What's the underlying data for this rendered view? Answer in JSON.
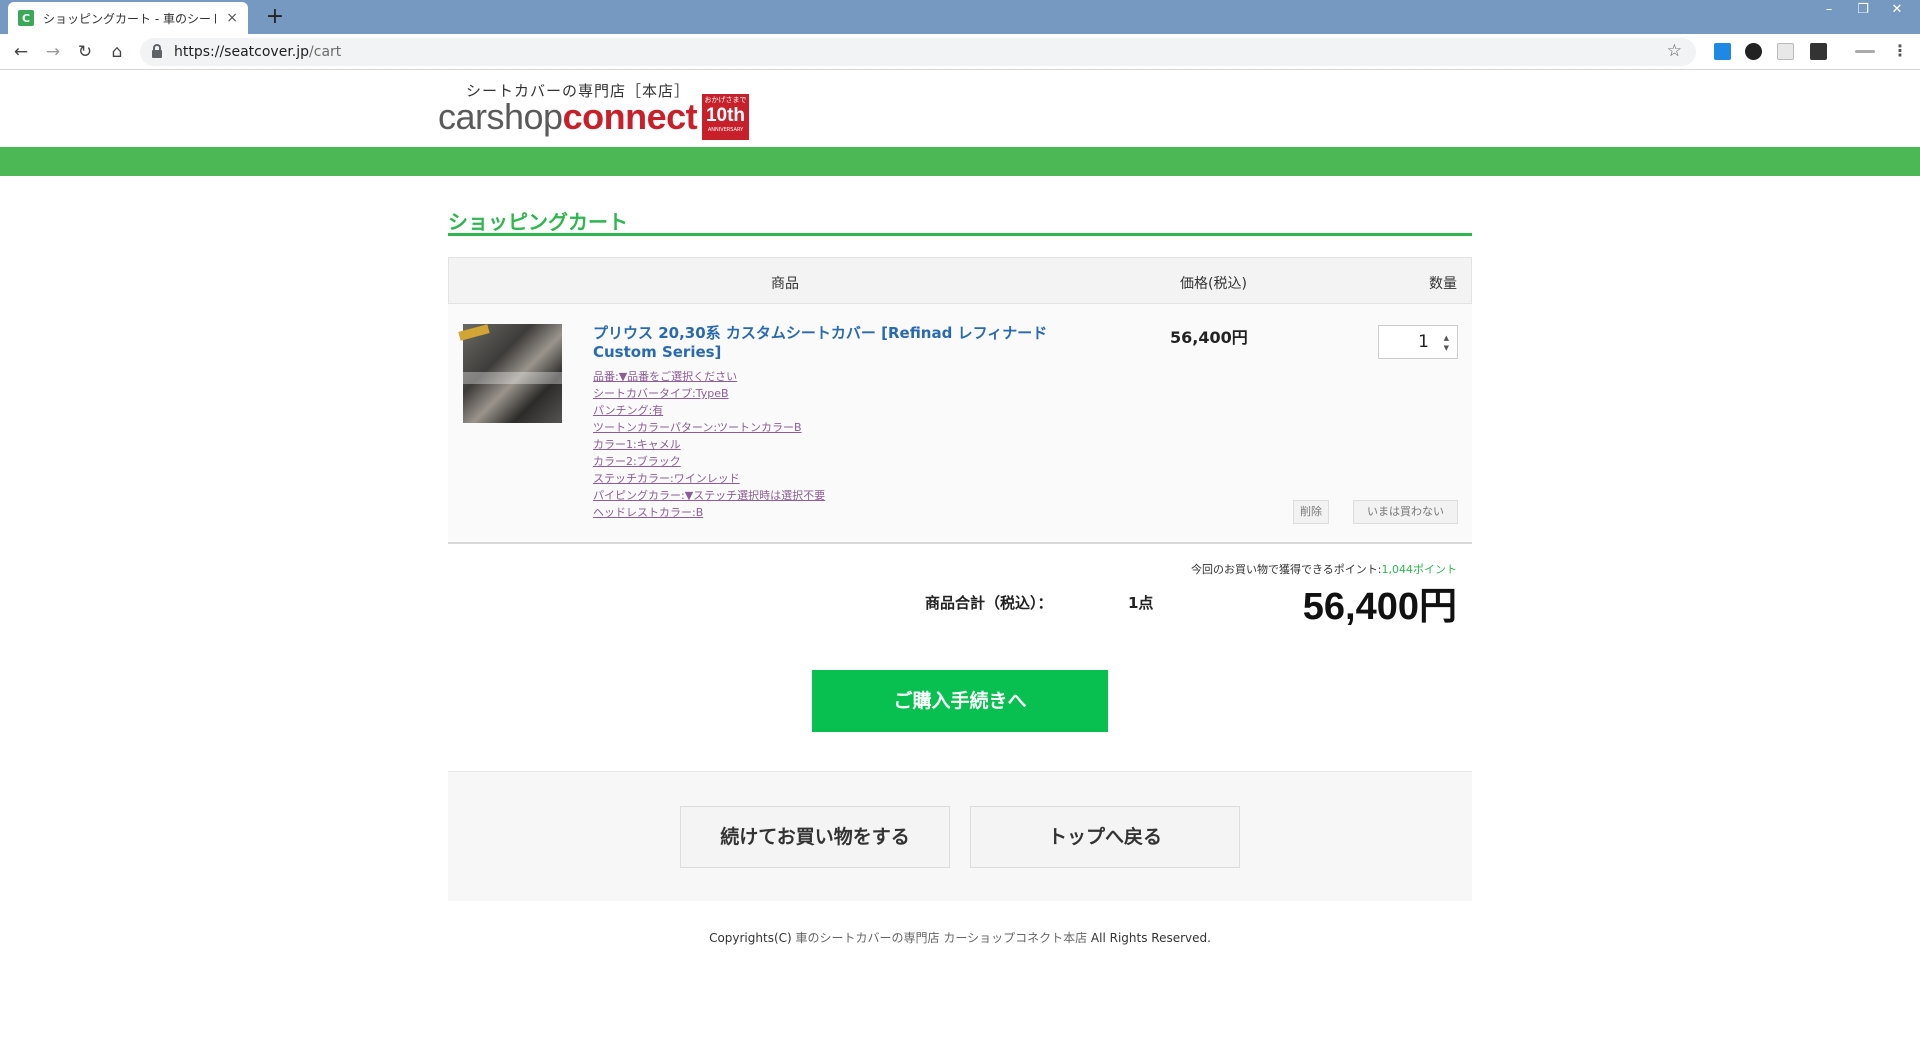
{
  "browser": {
    "tab_title": "ショッピングカート - 車のシートカバー(",
    "tab_favicon_letter": "C",
    "tab_close": "×",
    "new_tab": "+",
    "url_host": "https://seatcover.jp",
    "url_path": "/cart",
    "window_buttons": [
      "–",
      "❐",
      "✕"
    ]
  },
  "site": {
    "logo_tagline": "シートカバーの専門店［本店］",
    "logo_word_part1": "carshop",
    "logo_word_part2": "connect",
    "anniv_top": "おかげさまで",
    "anniv_num": "10th",
    "anniv_bottom": "ANNIVERSARY",
    "brand_green": "#4cb755",
    "brand_red": "#c8202a"
  },
  "cart": {
    "heading": "ショッピングカート",
    "columns": {
      "product": "商品",
      "price": "価格(税込)",
      "quantity": "数量"
    },
    "item": {
      "name": "プリウス 20,30系 カスタムシートカバー [Refinad レフィナード Custom Series]",
      "options": [
        "品番:▼品番をご選択ください",
        "シートカバータイプ:TypeB",
        "パンチング:有",
        "ツートンカラーパターン:ツートンカラーB",
        "カラー1:キャメル",
        "カラー2:ブラック",
        "ステッチカラー:ワインレッド",
        "パイピングカラー:▼ステッチ選択時は選択不要",
        "ヘッドレストカラー:B"
      ],
      "price": "56,400円",
      "quantity": "1",
      "delete_label": "削除",
      "later_label": "いまは買わない"
    },
    "points_prefix": "今回のお買い物で獲得できるポイント:",
    "points_value": "1,044ポイント",
    "total_label": "商品合計（税込）：",
    "total_count": "1点",
    "total_amount": "56,400円",
    "checkout_label": "ご購入手続きへ",
    "continue_label": "続けてお買い物をする",
    "top_label": "トップへ戻る"
  },
  "footer": {
    "prefix": "Copyrights(C) ",
    "link": "車のシートカバーの専門店 カーショップコネクト本店",
    "suffix": " All Rights Reserved."
  }
}
